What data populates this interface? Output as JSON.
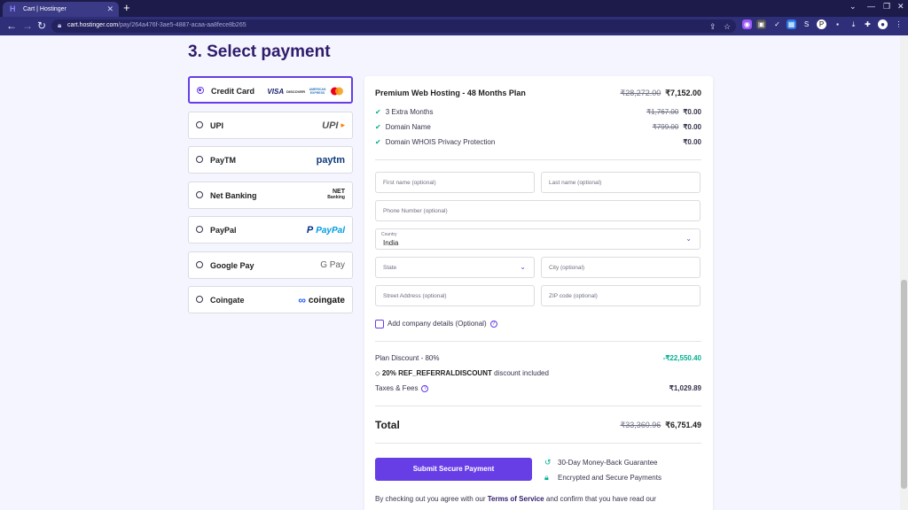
{
  "browser": {
    "tab_title": "Cart | Hostinger",
    "url_host": "cart.hostinger.com",
    "url_path": "/pay/264a476f-3ae5-4887-acaa-aa8fece8b265",
    "colors": {
      "tabbar": "#1c1b4a",
      "toolbar": "#2f2e78"
    }
  },
  "page": {
    "title": "3. Select payment",
    "accent_color": "#673de6"
  },
  "payment_methods": [
    {
      "label": "Credit Card",
      "selected": true
    },
    {
      "label": "UPI",
      "selected": false
    },
    {
      "label": "PayTM",
      "selected": false
    },
    {
      "label": "Net Banking",
      "selected": false
    },
    {
      "label": "PayPal",
      "selected": false
    },
    {
      "label": "Google Pay",
      "selected": false
    },
    {
      "label": "Coingate",
      "selected": false
    }
  ],
  "logos": {
    "visa": "VISA",
    "discover": "DISCOVER",
    "amex": "AMERICAN EXPRESS",
    "upi": "UPI",
    "paytm": "paytm",
    "netbanking": [
      "NET",
      "Banking"
    ],
    "paypal": "PayPal",
    "gpay": "G Pay",
    "coingate": "coingate"
  },
  "order": {
    "plan_name": "Premium Web Hosting - 48 Months Plan",
    "plan_old_price": "₹28,272.00",
    "plan_price": "₹7,152.00",
    "items": [
      {
        "label": "3 Extra Months",
        "old_price": "₹1,767.00",
        "price": "₹0.00"
      },
      {
        "label": "Domain Name",
        "old_price": "₹799.00",
        "price": "₹0.00"
      },
      {
        "label": "Domain WHOIS Privacy Protection",
        "old_price": "",
        "price": "₹0.00"
      }
    ]
  },
  "form": {
    "first_name_placeholder": "First name (optional)",
    "last_name_placeholder": "Last name (optional)",
    "phone_placeholder": "Phone Number (optional)",
    "country_label": "Country",
    "country_value": "India",
    "state_placeholder": "State",
    "city_placeholder": "City (optional)",
    "street_placeholder": "Street Address (optional)",
    "zip_placeholder": "ZIP code (optional)",
    "company_checkbox_label": "Add company details (Optional)"
  },
  "summary": {
    "plan_discount_label": "Plan Discount - 80%",
    "plan_discount_value": "-₹22,550.40",
    "coupon_code": "20% REF_REFERRALDISCOUNT",
    "coupon_suffix": "discount included",
    "taxes_label": "Taxes & Fees",
    "taxes_value": "₹1,029.89",
    "total_label": "Total",
    "total_old": "₹33,360.96",
    "total_value": "₹6,751.49"
  },
  "submit_label": "Submit Secure Payment",
  "guarantees": [
    "30-Day Money-Back Guarantee",
    "Encrypted and Secure Payments"
  ],
  "terms": {
    "prefix": "By checking out you agree with our",
    "link": "Terms of Service",
    "suffix": "and confirm that you have read our"
  }
}
